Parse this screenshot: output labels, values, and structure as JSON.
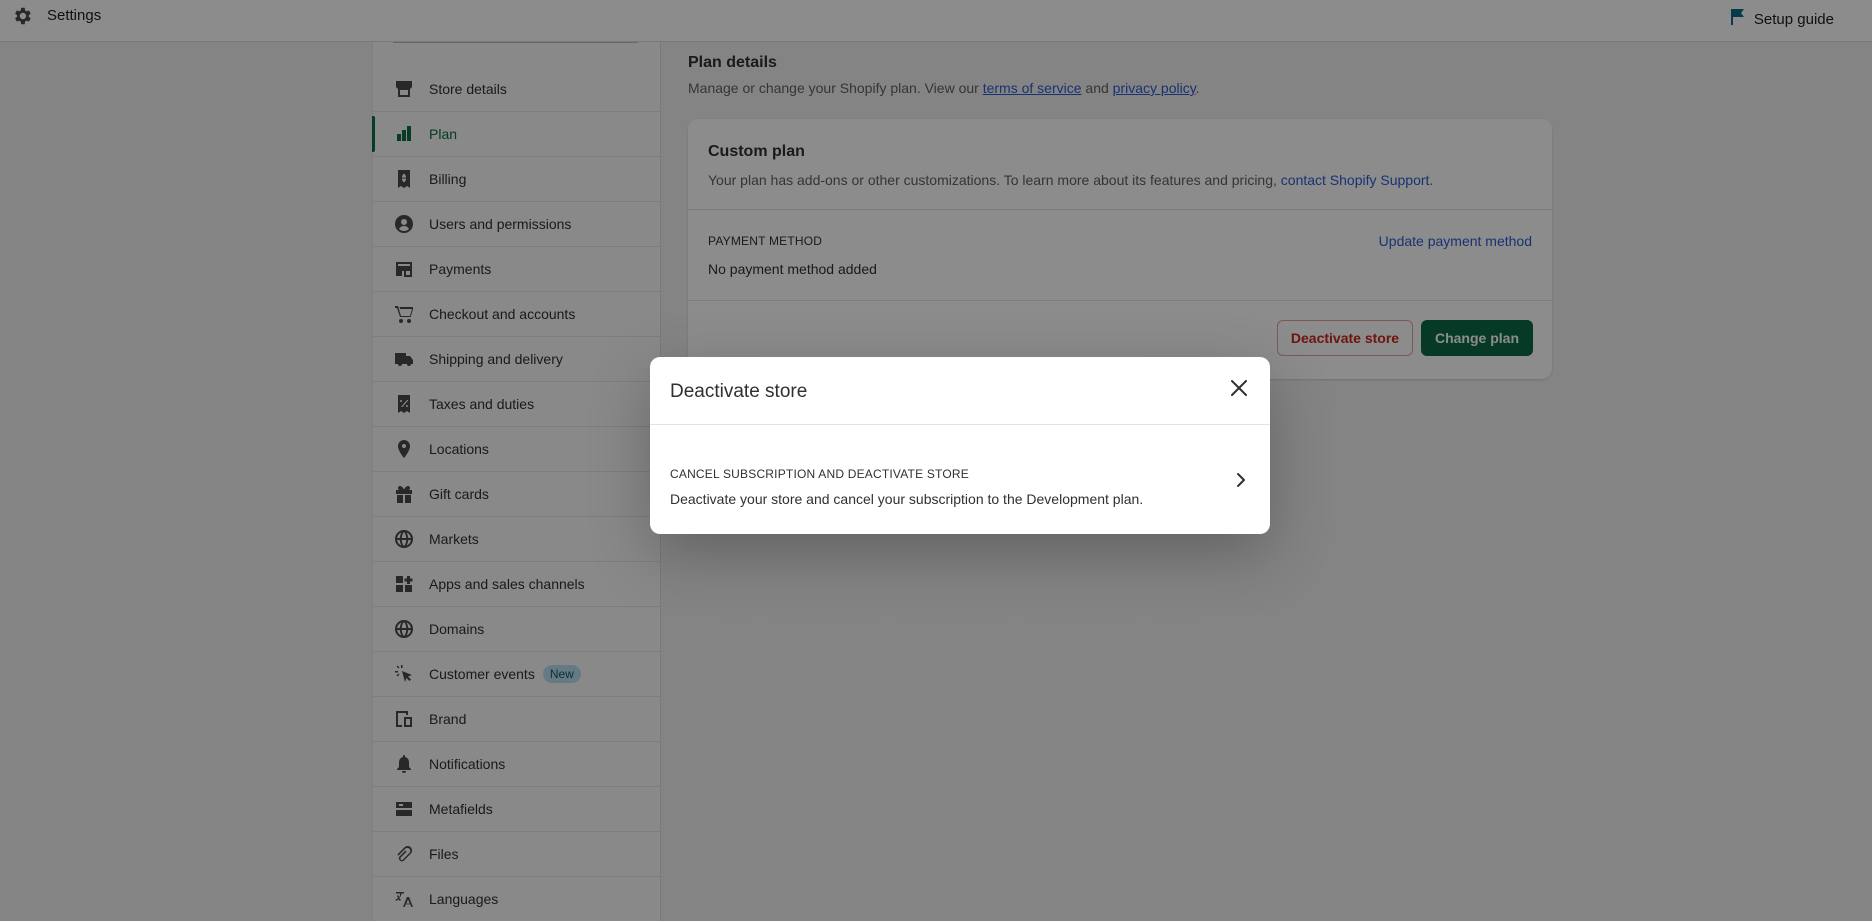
{
  "topbar": {
    "title": "Settings",
    "setup_guide": "Setup guide",
    "settings_icon": "gear-icon",
    "setup_icon": "flag-icon"
  },
  "sidebar": {
    "items": [
      {
        "label": "Store details",
        "icon": "store-icon"
      },
      {
        "label": "Plan",
        "icon": "plan-icon",
        "active": true
      },
      {
        "label": "Billing",
        "icon": "receipt-icon"
      },
      {
        "label": "Users and permissions",
        "icon": "user-icon"
      },
      {
        "label": "Payments",
        "icon": "payments-icon"
      },
      {
        "label": "Checkout and accounts",
        "icon": "cart-icon"
      },
      {
        "label": "Shipping and delivery",
        "icon": "truck-icon"
      },
      {
        "label": "Taxes and duties",
        "icon": "tax-icon"
      },
      {
        "label": "Locations",
        "icon": "location-pin-icon"
      },
      {
        "label": "Gift cards",
        "icon": "gift-icon"
      },
      {
        "label": "Markets",
        "icon": "globe-icon"
      },
      {
        "label": "Apps and sales channels",
        "icon": "apps-icon"
      },
      {
        "label": "Domains",
        "icon": "domains-globe-icon"
      },
      {
        "label": "Customer events",
        "icon": "cursor-click-icon",
        "badge": "New"
      },
      {
        "label": "Brand",
        "icon": "brand-icon"
      },
      {
        "label": "Notifications",
        "icon": "bell-icon"
      },
      {
        "label": "Metafields",
        "icon": "metafields-icon"
      },
      {
        "label": "Files",
        "icon": "paperclip-icon"
      },
      {
        "label": "Languages",
        "icon": "translate-icon"
      }
    ]
  },
  "main": {
    "title": "Plan details",
    "desc_prefix": "Manage or change your Shopify plan. View our ",
    "terms_link": "terms of service",
    "desc_and": " and ",
    "privacy_link": "privacy policy",
    "desc_suffix": ".",
    "card": {
      "title": "Custom plan",
      "desc": "Your plan has add-ons or other customizations. To learn more about its features and pricing, ",
      "support_link": "contact Shopify Support",
      "desc_end": ".",
      "payment_label": "PAYMENT METHOD",
      "update_payment": "Update payment method",
      "payment_value": "No payment method added",
      "deactivate_button": "Deactivate store",
      "change_plan_button": "Change plan"
    }
  },
  "modal": {
    "title": "Deactivate store",
    "close_icon": "close-icon",
    "option_title": "CANCEL SUBSCRIPTION AND DEACTIVATE STORE",
    "option_desc": "Deactivate your store and cancel your subscription to the Development plan.",
    "option_icon": "chevron-right-icon"
  },
  "colors": {
    "accent_green": "#0b6b45",
    "link_blue": "#2c5bd1",
    "danger_red": "#c4291c",
    "badge_blue": "#b6e0f0"
  }
}
